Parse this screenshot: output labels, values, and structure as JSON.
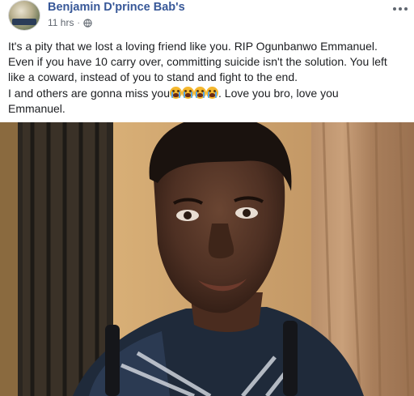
{
  "post": {
    "author": "Benjamin D'prince Bab's",
    "time": "11 hrs",
    "separator": "·",
    "privacy_icon": "globe-icon",
    "more_icon": "more-options-icon",
    "text_lines": [
      "It's a pity that we lost a loving friend like you. RIP Ogunbanwo Emmanuel.",
      "Even if you have 10 carry over, committing suicide isn't the solution. You left",
      "like a coward, instead of you to stand and fight to the end."
    ],
    "line4_before": "I and others are gonna miss you",
    "line4_emoji_count": 4,
    "line4_emoji": "loudly-crying-face-emoji",
    "line4_after": ". Love you bro, love you",
    "line5": "Emmanuel.",
    "photo": "selfie-photo"
  },
  "colors": {
    "author_link": "#385898",
    "meta_text": "#606770",
    "body_text": "#1c1e21"
  }
}
